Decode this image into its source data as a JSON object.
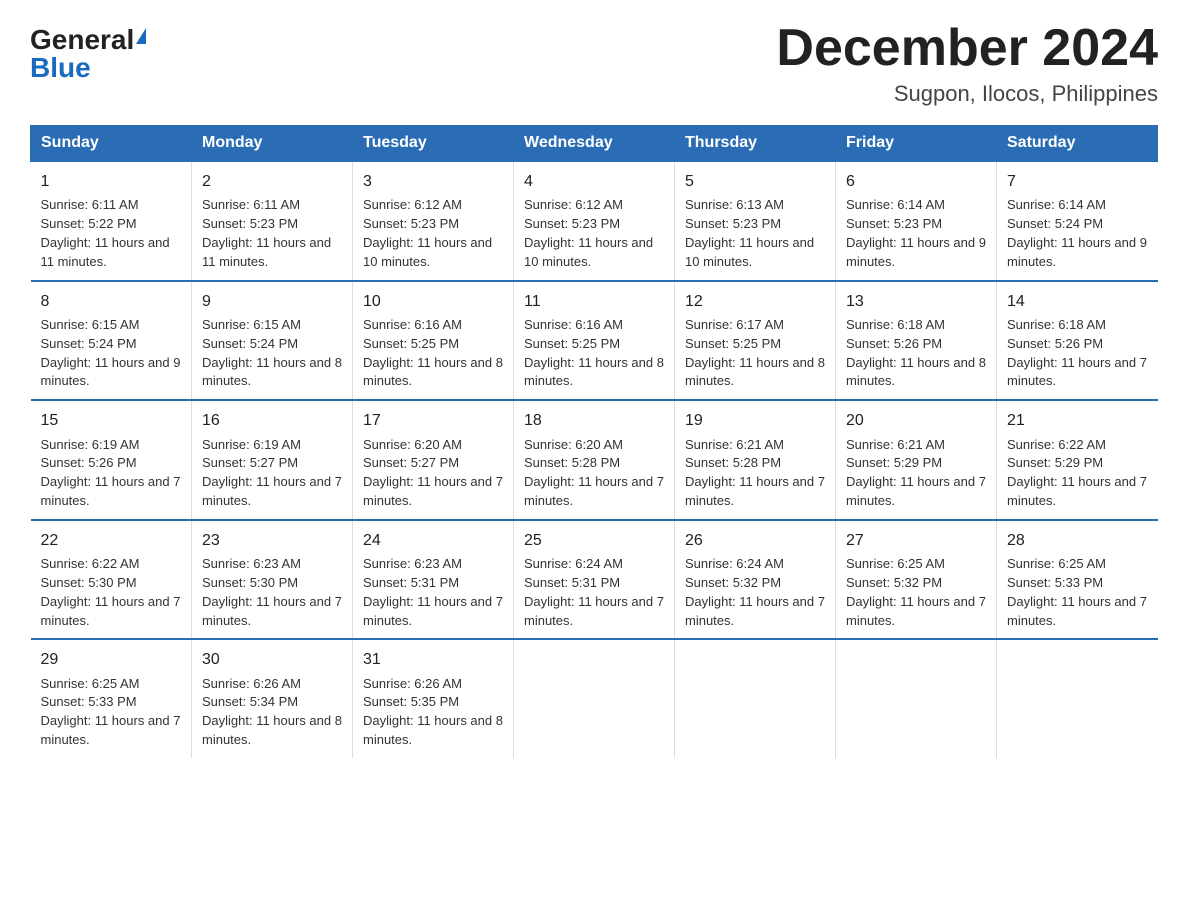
{
  "header": {
    "logo_general": "General",
    "logo_blue": "Blue",
    "month_title": "December 2024",
    "location": "Sugpon, Ilocos, Philippines"
  },
  "days_of_week": [
    "Sunday",
    "Monday",
    "Tuesday",
    "Wednesday",
    "Thursday",
    "Friday",
    "Saturday"
  ],
  "weeks": [
    [
      {
        "day": "1",
        "sunrise": "6:11 AM",
        "sunset": "5:22 PM",
        "daylight": "11 hours and 11 minutes."
      },
      {
        "day": "2",
        "sunrise": "6:11 AM",
        "sunset": "5:23 PM",
        "daylight": "11 hours and 11 minutes."
      },
      {
        "day": "3",
        "sunrise": "6:12 AM",
        "sunset": "5:23 PM",
        "daylight": "11 hours and 10 minutes."
      },
      {
        "day": "4",
        "sunrise": "6:12 AM",
        "sunset": "5:23 PM",
        "daylight": "11 hours and 10 minutes."
      },
      {
        "day": "5",
        "sunrise": "6:13 AM",
        "sunset": "5:23 PM",
        "daylight": "11 hours and 10 minutes."
      },
      {
        "day": "6",
        "sunrise": "6:14 AM",
        "sunset": "5:23 PM",
        "daylight": "11 hours and 9 minutes."
      },
      {
        "day": "7",
        "sunrise": "6:14 AM",
        "sunset": "5:24 PM",
        "daylight": "11 hours and 9 minutes."
      }
    ],
    [
      {
        "day": "8",
        "sunrise": "6:15 AM",
        "sunset": "5:24 PM",
        "daylight": "11 hours and 9 minutes."
      },
      {
        "day": "9",
        "sunrise": "6:15 AM",
        "sunset": "5:24 PM",
        "daylight": "11 hours and 8 minutes."
      },
      {
        "day": "10",
        "sunrise": "6:16 AM",
        "sunset": "5:25 PM",
        "daylight": "11 hours and 8 minutes."
      },
      {
        "day": "11",
        "sunrise": "6:16 AM",
        "sunset": "5:25 PM",
        "daylight": "11 hours and 8 minutes."
      },
      {
        "day": "12",
        "sunrise": "6:17 AM",
        "sunset": "5:25 PM",
        "daylight": "11 hours and 8 minutes."
      },
      {
        "day": "13",
        "sunrise": "6:18 AM",
        "sunset": "5:26 PM",
        "daylight": "11 hours and 8 minutes."
      },
      {
        "day": "14",
        "sunrise": "6:18 AM",
        "sunset": "5:26 PM",
        "daylight": "11 hours and 7 minutes."
      }
    ],
    [
      {
        "day": "15",
        "sunrise": "6:19 AM",
        "sunset": "5:26 PM",
        "daylight": "11 hours and 7 minutes."
      },
      {
        "day": "16",
        "sunrise": "6:19 AM",
        "sunset": "5:27 PM",
        "daylight": "11 hours and 7 minutes."
      },
      {
        "day": "17",
        "sunrise": "6:20 AM",
        "sunset": "5:27 PM",
        "daylight": "11 hours and 7 minutes."
      },
      {
        "day": "18",
        "sunrise": "6:20 AM",
        "sunset": "5:28 PM",
        "daylight": "11 hours and 7 minutes."
      },
      {
        "day": "19",
        "sunrise": "6:21 AM",
        "sunset": "5:28 PM",
        "daylight": "11 hours and 7 minutes."
      },
      {
        "day": "20",
        "sunrise": "6:21 AM",
        "sunset": "5:29 PM",
        "daylight": "11 hours and 7 minutes."
      },
      {
        "day": "21",
        "sunrise": "6:22 AM",
        "sunset": "5:29 PM",
        "daylight": "11 hours and 7 minutes."
      }
    ],
    [
      {
        "day": "22",
        "sunrise": "6:22 AM",
        "sunset": "5:30 PM",
        "daylight": "11 hours and 7 minutes."
      },
      {
        "day": "23",
        "sunrise": "6:23 AM",
        "sunset": "5:30 PM",
        "daylight": "11 hours and 7 minutes."
      },
      {
        "day": "24",
        "sunrise": "6:23 AM",
        "sunset": "5:31 PM",
        "daylight": "11 hours and 7 minutes."
      },
      {
        "day": "25",
        "sunrise": "6:24 AM",
        "sunset": "5:31 PM",
        "daylight": "11 hours and 7 minutes."
      },
      {
        "day": "26",
        "sunrise": "6:24 AM",
        "sunset": "5:32 PM",
        "daylight": "11 hours and 7 minutes."
      },
      {
        "day": "27",
        "sunrise": "6:25 AM",
        "sunset": "5:32 PM",
        "daylight": "11 hours and 7 minutes."
      },
      {
        "day": "28",
        "sunrise": "6:25 AM",
        "sunset": "5:33 PM",
        "daylight": "11 hours and 7 minutes."
      }
    ],
    [
      {
        "day": "29",
        "sunrise": "6:25 AM",
        "sunset": "5:33 PM",
        "daylight": "11 hours and 7 minutes."
      },
      {
        "day": "30",
        "sunrise": "6:26 AM",
        "sunset": "5:34 PM",
        "daylight": "11 hours and 8 minutes."
      },
      {
        "day": "31",
        "sunrise": "6:26 AM",
        "sunset": "5:35 PM",
        "daylight": "11 hours and 8 minutes."
      },
      null,
      null,
      null,
      null
    ]
  ]
}
